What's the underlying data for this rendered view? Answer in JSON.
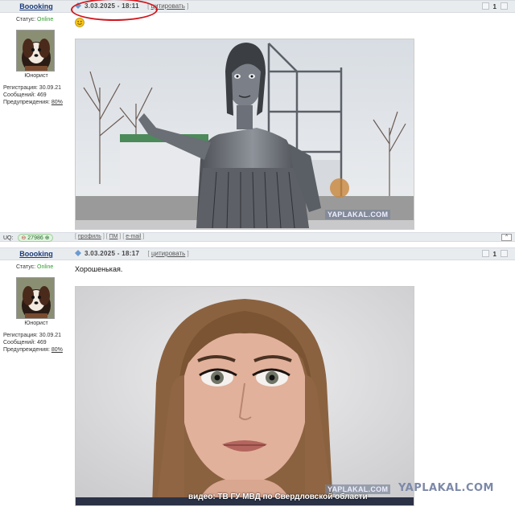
{
  "posts": [
    {
      "author": "Boooking",
      "date": "3.03.2025 - 18:11",
      "quote_label": "цитировать",
      "post_number": "1",
      "status_label": "Статус:",
      "status_value": "Online",
      "rank": "Юнорист",
      "registration": "Регистрация: 30.09.21",
      "messages": "Сообщений: 469",
      "warnings_label": "Предупреждения:",
      "warnings_value": "80%",
      "text": "",
      "photo_watermark": "YAPLAKAL.COM"
    },
    {
      "author": "Boooking",
      "date": "3.03.2025 - 18:17",
      "quote_label": "цитировать",
      "post_number": "1",
      "status_label": "Статус:",
      "status_value": "Online",
      "rank": "Юнорист",
      "registration": "Регистрация: 30.09.21",
      "messages": "Сообщений: 469",
      "warnings_label": "Предупреждения:",
      "warnings_value": "80%",
      "text": "Хорошенькая.",
      "photo_caption": "видео: ТВ ГУ МВД по Свердловской области",
      "photo_watermark": "YAPLAKAL.COM"
    }
  ],
  "footer": {
    "uq_label": "UQ:",
    "uq_value": "27986",
    "profile_link": "профиль",
    "pm_link": "ПМ",
    "email_link": "e-mail",
    "up_label": "^"
  },
  "site_watermark": "YAPLAKAL.COM",
  "colors": {
    "header_bg": "#e9ecef",
    "author_link": "#1a3a7a",
    "online": "#2e9b2e",
    "highlight": "#d0161d"
  }
}
